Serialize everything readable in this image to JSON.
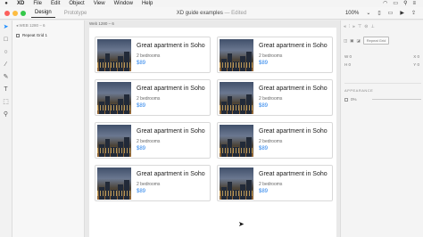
{
  "menubar": {
    "apple": "",
    "items": [
      "XD",
      "File",
      "Edit",
      "Object",
      "View",
      "Window",
      "Help"
    ],
    "status_icons": [
      "wifi-icon",
      "battery-icon",
      "search-icon",
      "list-icon"
    ]
  },
  "titlebar": {
    "tabs": [
      "Design",
      "Prototype"
    ],
    "doc_title": "XD guide examples",
    "separator": "—",
    "status": "Edited",
    "zoom": "100%",
    "icons": [
      "device-preview-icon",
      "desktop-icon",
      "play-icon",
      "share-icon"
    ]
  },
  "toolbar": {
    "tools": [
      {
        "name": "select-tool-icon",
        "glyph": "➤"
      },
      {
        "name": "rectangle-tool-icon",
        "glyph": "□"
      },
      {
        "name": "ellipse-tool-icon",
        "glyph": "○"
      },
      {
        "name": "line-tool-icon",
        "glyph": "∕"
      },
      {
        "name": "pen-tool-icon",
        "glyph": "✎"
      },
      {
        "name": "text-tool-icon",
        "glyph": "T"
      },
      {
        "name": "artboard-tool-icon",
        "glyph": "⬚"
      },
      {
        "name": "zoom-tool-icon",
        "glyph": "⚲"
      }
    ]
  },
  "layers": {
    "breadcrumb": "◂  WEB 1280 – 6",
    "item": "Repeat Grid 1"
  },
  "canvas": {
    "artboard_label": "Web 1280 – 6"
  },
  "cards": [
    {
      "title": "Great apartment in Soho",
      "beds": "2 bedrooms",
      "price": "$89"
    },
    {
      "title": "Great apartment in Soho",
      "beds": "2 bedrooms",
      "price": "$89"
    },
    {
      "title": "Great apartment in Soho",
      "beds": "2 bedrooms",
      "price": "$89"
    },
    {
      "title": "Great apartment in Soho",
      "beds": "2 bedrooms",
      "price": "$89"
    },
    {
      "title": "Great apartment in Soho",
      "beds": "2 bedrooms",
      "price": "$89"
    },
    {
      "title": "Great apartment in Soho",
      "beds": "2 bedrooms",
      "price": "$89"
    },
    {
      "title": "Great apartment in Soho",
      "beds": "2 bedrooms",
      "price": "$89"
    },
    {
      "title": "Great apartment in Soho",
      "beds": "2 bedrooms",
      "price": "$89"
    }
  ],
  "props": {
    "repeat_grid_button": "Repeat Grid",
    "w_label": "W",
    "w_value": "0",
    "h_label": "H",
    "h_value": "0",
    "x_label": "X",
    "x_value": "0",
    "y_label": "Y",
    "y_value": "0",
    "appearance_label": "APPEARANCE",
    "opacity_value": "0%"
  },
  "colors": {
    "accent": "#2680eb",
    "close": "#fc605c",
    "minimize": "#fdbc40",
    "maximize": "#34c84a"
  }
}
